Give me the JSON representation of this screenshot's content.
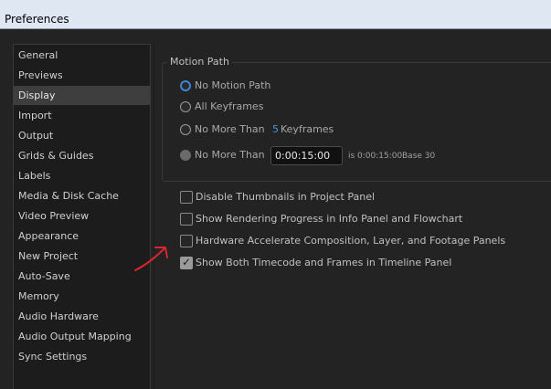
{
  "window": {
    "title": "Preferences"
  },
  "sidebar": {
    "items": [
      {
        "label": "General",
        "selected": false
      },
      {
        "label": "Previews",
        "selected": false
      },
      {
        "label": "Display",
        "selected": true
      },
      {
        "label": "Import",
        "selected": false
      },
      {
        "label": "Output",
        "selected": false
      },
      {
        "label": "Grids & Guides",
        "selected": false
      },
      {
        "label": "Labels",
        "selected": false
      },
      {
        "label": "Media & Disk Cache",
        "selected": false
      },
      {
        "label": "Video Preview",
        "selected": false
      },
      {
        "label": "Appearance",
        "selected": false
      },
      {
        "label": "New Project",
        "selected": false
      },
      {
        "label": "Auto-Save",
        "selected": false
      },
      {
        "label": "Memory",
        "selected": false
      },
      {
        "label": "Audio Hardware",
        "selected": false
      },
      {
        "label": "Audio Output Mapping",
        "selected": false
      },
      {
        "label": "Sync Settings",
        "selected": false
      }
    ]
  },
  "motion_path": {
    "title": "Motion Path",
    "options": [
      {
        "label": "No Motion Path",
        "state": "focused"
      },
      {
        "label": "All Keyframes",
        "state": "normal"
      },
      {
        "label": "No More Than",
        "state": "normal"
      },
      {
        "label": "No More Than",
        "state": "disabled"
      }
    ],
    "keyframes_value": "5",
    "keyframes_label": "Keyframes",
    "timecode_value": "0:00:15:00",
    "timecode_equiv": "is 0:00:15:00",
    "timecode_base": "Base 30"
  },
  "checkboxes": [
    {
      "label": "Disable Thumbnails in Project Panel",
      "checked": false
    },
    {
      "label": "Show Rendering Progress in Info Panel and Flowchart",
      "checked": false
    },
    {
      "label": "Hardware Accelerate Composition, Layer, and Footage Panels",
      "checked": false
    },
    {
      "label": "Show Both Timecode and Frames in Timeline Panel",
      "checked": true
    }
  ],
  "colors": {
    "accent": "#3c86d4",
    "annotation": "#d8262a",
    "titlebar": "#dfe7f3"
  }
}
